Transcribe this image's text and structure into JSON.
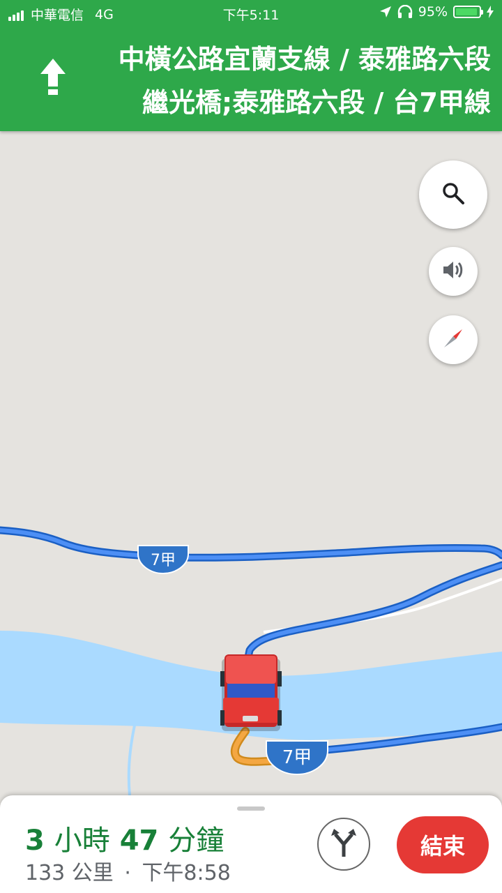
{
  "status_bar": {
    "carrier": "中華電信",
    "network": "4G",
    "time": "下午5:11",
    "battery": "95%"
  },
  "navigation": {
    "direction_icon": "arrow-up-icon",
    "instruction_line1": "中橫公路宜蘭支線 / 泰雅路六段",
    "instruction_line2": "繼光橋;泰雅路六段 / 台7甲線"
  },
  "map": {
    "route_shields": [
      "7甲",
      "7甲"
    ],
    "controls": {
      "search_icon": "search-icon",
      "sound_icon": "speaker-icon",
      "compass_icon": "compass-icon"
    },
    "colors": {
      "route": "#4285f4",
      "route_traveled": "#f4a742",
      "water": "#aadaff",
      "land": "#e5e3df",
      "vehicle": "#e53935"
    }
  },
  "trip": {
    "eta_hours": "3",
    "eta_hours_unit": "小時",
    "eta_minutes": "47",
    "eta_minutes_unit": "分鐘",
    "distance": "133 公里",
    "separator": "·",
    "arrival": "下午8:58",
    "alternate_icon": "alternate-routes-icon",
    "end_label": "結束"
  },
  "header_color": "#2ea84a"
}
